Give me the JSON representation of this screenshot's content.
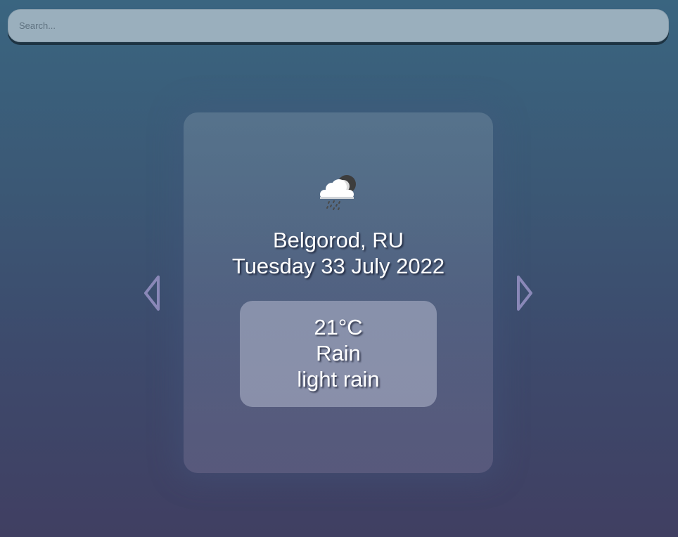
{
  "search": {
    "placeholder": "Search...",
    "value": ""
  },
  "weather": {
    "icon": "rain-cloud-moon-icon",
    "city": "Belgorod, RU",
    "date": "Tuesday 33 July 2022",
    "temperature": "21°C",
    "condition": "Rain",
    "description": "light rain"
  },
  "navigation": {
    "previous_icon": "chevron-left-icon",
    "next_icon": "chevron-right-icon"
  },
  "colors": {
    "background_top": "#3a6580",
    "background_bottom": "#403f62",
    "arrow": "#8a88b8",
    "text": "#ffffff"
  }
}
